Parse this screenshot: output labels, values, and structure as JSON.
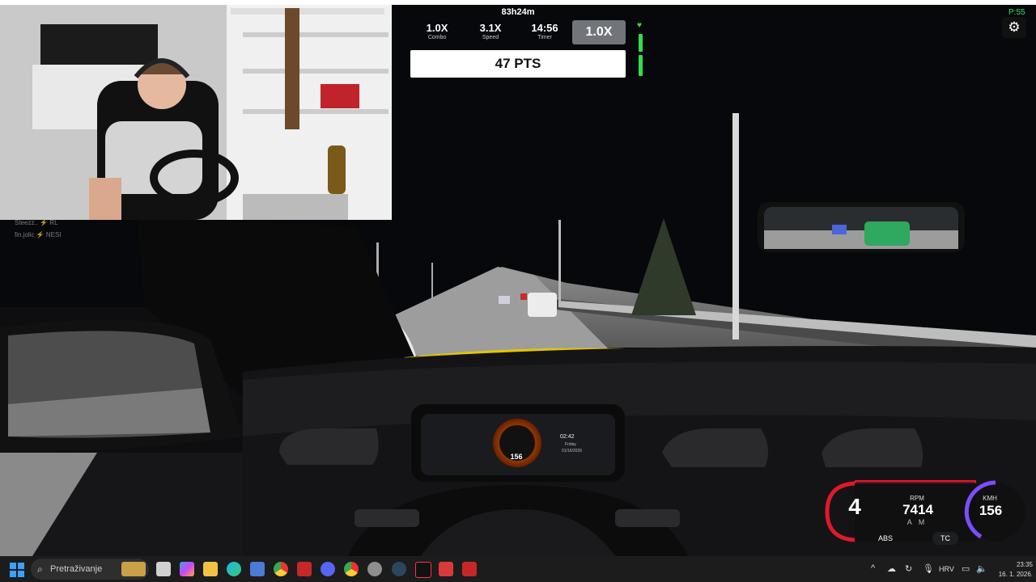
{
  "hud": {
    "session_time": "83h24m",
    "stats": [
      {
        "value": "1.0X",
        "label": "Combo"
      },
      {
        "value": "3.1X",
        "label": "Speed"
      },
      {
        "value": "14:56",
        "label": "Timer"
      }
    ],
    "multiplier": "1.0X",
    "points": "47 PTS",
    "ping": "P:55",
    "settings_icon": "gear-icon",
    "accent_color": "#2ee04a"
  },
  "chat": {
    "lines": [
      "Steezz..  ⚡ RL",
      "fin.jolic  ⚡ NESI"
    ]
  },
  "speedometer": {
    "gear": "4",
    "rpm_label": "RPM",
    "rpm_value": "7414",
    "am_label": "A M",
    "speed_unit": "KMH",
    "speed_value": "156",
    "abs_label": "ABS",
    "tc_label": "TC",
    "rpm_arc_color": "#e0182b",
    "speed_arc_color": "#7b4dff"
  },
  "dash_cluster": {
    "speed": "156",
    "time": "02:42",
    "day": "Friday",
    "date": "01/16/2026"
  },
  "taskbar": {
    "search_placeholder": "Pretraživanje",
    "language": "HRV",
    "clock_time": "23:35",
    "clock_date": "16. 1. 2026.",
    "apps": [
      "file-explorer-icon",
      "copilot-icon",
      "folder-icon",
      "edge-icon",
      "store-icon",
      "chrome-icon",
      "game-app-icon",
      "discord-icon",
      "chrome-icon",
      "settings-icon",
      "steam-icon",
      "tiktok-icon",
      "tf-icon",
      "game-app-icon"
    ]
  }
}
